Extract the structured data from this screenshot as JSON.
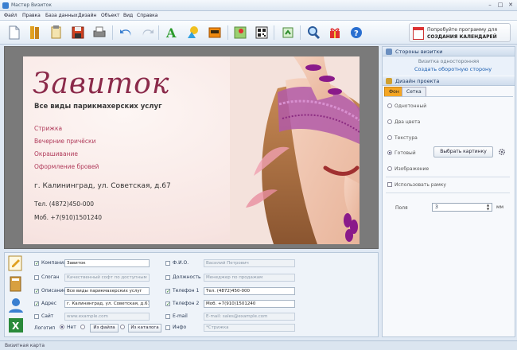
{
  "window": {
    "title": "Мастер Визиток"
  },
  "menu": [
    "Файл",
    "Правка",
    "База данных",
    "Дизайн",
    "Объект",
    "Вид",
    "Справка"
  ],
  "promo": {
    "line1": "Попробуйте программу для",
    "line2": "СОЗДАНИЯ КАЛЕНДАРЕЙ"
  },
  "card": {
    "name": "Завиток",
    "description": "Все виды парикмахерских услуг",
    "services": [
      "Стрижка",
      "Вечерние причёски",
      "Окрашивание",
      "Оформление бровей"
    ],
    "address": "г. Калининград, ул. Советская, д.67",
    "phone1": "Тел. (4872)450-000",
    "phone2": "Моб. +7(910)1501240"
  },
  "sides_panel": {
    "header": "Стороны визитки",
    "note": "Визитка односторонняя",
    "link": "Создать оборотную сторону"
  },
  "design_panel": {
    "header": "Дизайн проекта",
    "tabs": [
      "Фон",
      "Сетка"
    ],
    "bg_options": [
      "Однотонный",
      "Два цвета",
      "Текстура",
      "Готовый",
      "Изображение"
    ],
    "selected_option": "Готовый",
    "pick_button": "Выбрать картинку",
    "frame_label": "Использовать рамку",
    "margin_label": "Поля",
    "margin_value": "3",
    "margin_unit": "мм"
  },
  "fields": {
    "company": {
      "label": "Компания",
      "value": "Завиток",
      "checked": true
    },
    "slogan": {
      "label": "Слоган",
      "value": "Качественный софт по доступным ценам",
      "checked": false
    },
    "description": {
      "label": "Описание",
      "value": "Все виды парикмахерских услуг",
      "checked": true
    },
    "address": {
      "label": "Адрес",
      "value": "г. Калининград, ул. Советская, д.67",
      "checked": true
    },
    "site": {
      "label": "Сайт",
      "value": "www.example.com",
      "checked": false
    },
    "fio": {
      "label": "Ф.И.О.",
      "value": "Василий Петрович",
      "checked": false
    },
    "position": {
      "label": "Должность",
      "value": "Менеджер по продажам",
      "checked": false
    },
    "phone1": {
      "label": "Телефон 1",
      "value": "Тел. (4872)450-000",
      "checked": true
    },
    "phone2": {
      "label": "Телефон 2",
      "value": "Моб. +7(910)1501240",
      "checked": true
    },
    "email": {
      "label": "E-mail",
      "value": "E-mail: sales@example.com",
      "checked": false
    },
    "info": {
      "label": "Инфо",
      "value": "*Стрижка",
      "checked": false
    },
    "logo": {
      "label": "Логотип",
      "opt_none": "Нет",
      "opt_file": "Из файла",
      "opt_catalog": "Из каталога"
    }
  },
  "status": {
    "text": "Визитная карта"
  }
}
